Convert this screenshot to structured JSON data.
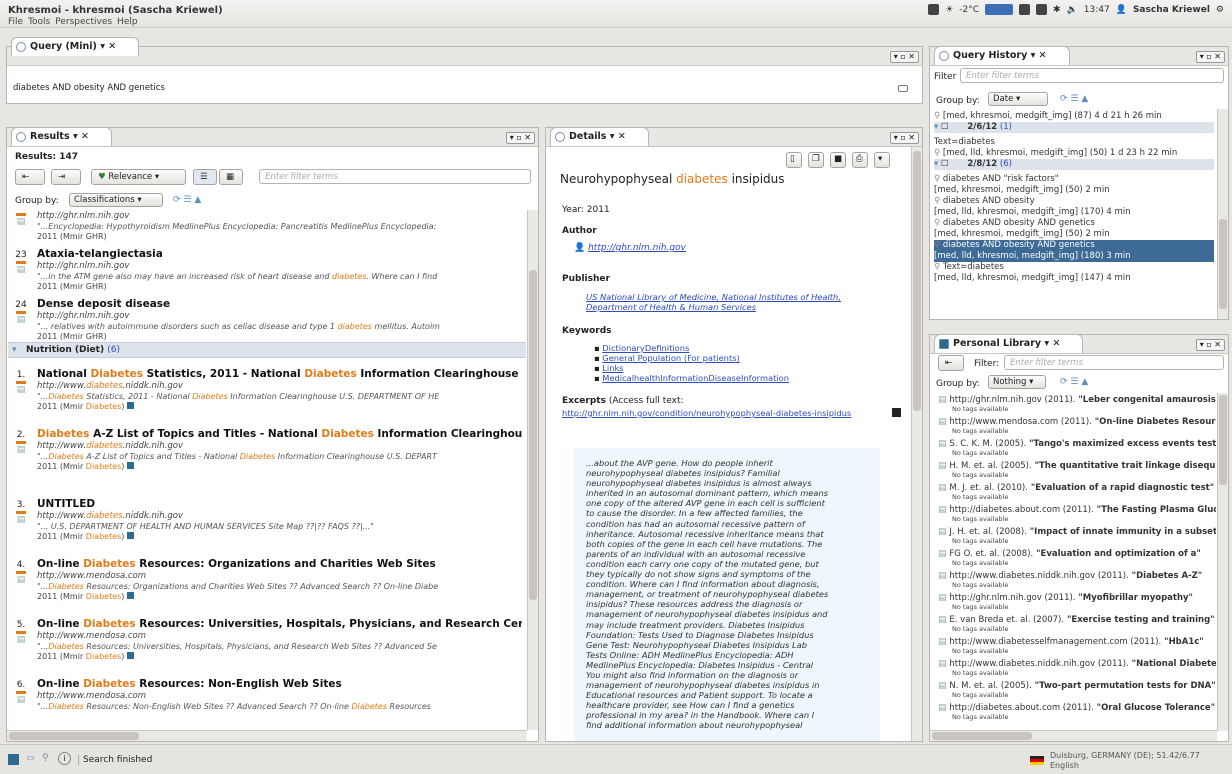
{
  "window": {
    "title": "Khresmoi - khresmoi (Sascha Kriewel)",
    "menu": [
      "File",
      "Tools",
      "Perspectives",
      "Help"
    ]
  },
  "tray": {
    "temp": "-2°C",
    "time": "13:47",
    "user": "Sascha Kriewel"
  },
  "query_pane": {
    "tab": "Query (Mini)",
    "query": "diabetes AND obesity AND genetics"
  },
  "results": {
    "tab": "Results",
    "count": "Results: 147",
    "sort": "Relevance",
    "filter_placeholder": "Enter filter terms",
    "group_label": "Group by:",
    "group_value": "Classifications",
    "group_nutrition": "Nutrition (Diet)",
    "group_nutrition_count": "(6)",
    "items": [
      {
        "rank": "",
        "title": "",
        "url": "http://ghr.nlm.nih.gov",
        "snippet": "\"...Encyclopedia: Hypothyroidism MedlinePlus Encyclopedia: Pancreatitis MedlinePlus Encyclopedia:",
        "date": "2011 (Mmir GHR)"
      },
      {
        "rank": "23",
        "title": "Ataxia-telangiectasia",
        "url": "http://ghr.nlm.nih.gov",
        "snippet": "\"...in the ATM gene also may have an increased risk of heart disease and diabetes. Where can I find",
        "date": "2011 (Mmir GHR)"
      },
      {
        "rank": "24",
        "title": "Dense deposit disease",
        "url": "http://ghr.nlm.nih.gov",
        "snippet": "\"... relatives with autoimmune disorders such as celiac disease and type 1 diabetes mellitus. Autoim",
        "date": "2011 (Mmir GHR)"
      },
      {
        "rank": "1.",
        "title": "National Diabetes Statistics, 2011 - National Diabetes Information Clearinghouse",
        "url": "http://www.diabetes.niddk.nih.gov",
        "snippet": "\"...Diabetes Statistics, 2011 - National Diabetes Information Clearinghouse U.S. DEPARTMENT OF HE",
        "date": "2011 (Mmir Diabetes)"
      },
      {
        "rank": "2.",
        "title": "Diabetes A-Z List of Topics and Titles - National Diabetes Information Clearinghouse",
        "url": "http://www.diabetes.niddk.nih.gov",
        "snippet": "\"...Diabetes A-Z List of Topics and Titles - National Diabetes Information Clearinghouse U.S. DEPART",
        "date": "2011 (Mmir Diabetes)"
      },
      {
        "rank": "3.",
        "title": "UNTITLED",
        "url": "http://www.diabetes.niddk.nih.gov",
        "snippet": "\"... U.S. DEPARTMENT OF HEALTH AND HUMAN SERVICES Site Map ??|?? FAQS ??|...\"",
        "date": "2011 (Mmir Diabetes)"
      },
      {
        "rank": "4.",
        "title": "On-line Diabetes Resources: Organizations and Charities Web Sites",
        "url": "http://www.mendosa.com",
        "snippet": "\"...Diabetes Resources: Organizations and Charities Web Sites ?? Advanced Search ?? On-line Diabe",
        "date": "2011 (Mmir Diabetes)"
      },
      {
        "rank": "5.",
        "title": "On-line Diabetes Resources: Universities, Hospitals, Physicians, and Research Centers",
        "url": "http://www.mendosa.com",
        "snippet": "\"...Diabetes Resources: Universities, Hospitals, Physicians, and Research Web Sites ?? Advanced Se",
        "date": "2011 (Mmir Diabetes)"
      },
      {
        "rank": "6.",
        "title": "On-line Diabetes Resources: Non-English Web Sites",
        "url": "http://www.mendosa.com",
        "snippet": "\"...Diabetes Resources: Non-English Web Sites ?? Advanced Search ?? On-line Diabetes Resources",
        "date": ""
      }
    ]
  },
  "details": {
    "tab": "Details",
    "title_pre": "Neurohypophyseal ",
    "title_hl": "diabetes",
    "title_post": " insipidus",
    "year": "Year: 2011",
    "author_label": "Author",
    "author_link": "http://ghr.nlm.nih.gov",
    "publisher_label": "Publisher",
    "publisher": "US National Library of Medicine, National Institutes of Health, Department of Health & Human Services",
    "keywords_label": "Keywords",
    "keywords": [
      "DictionaryDefinitions",
      "General Population (For patients)",
      "Links",
      "MedicalhealthInformationDiseaseInformation"
    ],
    "excerpt_label": "Excerpts",
    "excerpt_access": "(Access full text:",
    "excerpt_link": "http://ghr.nlm.nih.gov/condition/neurohypophyseal-diabetes-insipidus",
    "excerpt_text": "...about the AVP gene. How do people inherit\nneurohypophyseal diabetes insipidus? Familial\nneurohypophyseal diabetes insipidus is almost always\ninherited in an autosomal dominant pattern, which means\none copy of the altered AVP gene in each cell is sufficient\nto cause the disorder. In a few affected families, the\ncondition has had an autosomal recessive pattern of\ninheritance. Autosomal recessive inheritance means that\nboth copies of the gene in each cell have mutations. The\nparents of an individual with an autosomal recessive\ncondition each carry one copy of the mutated gene, but\nthey typically do not show signs and symptoms of the\ncondition. Where can I find information about diagnosis,\nmanagement, or treatment of neurohypophyseal diabetes\ninsipidus? These resources address the diagnosis or\nmanagement of neurohypophyseal diabetes insipidus and\nmay include treatment providers. Diabetes Insipidus\nFoundation: Tests Used to Diagnose Diabetes Insipidus\nGene Test: Neurohypophyseal Diabetes Insipidus Lab\nTests Online: ADH MedlinePlus Encyclopedia: ADH\nMedlinePlus Encyclopedia: Diabetes Insipidus - Central\nYou might also find information on the diagnosis or\nmanagement of neurohypophyseal diabetes insipidus in\nEducational resources and Patient support. To locate a\nhealthcare provider, see How can I find a genetics\nprofessional in my area? in the Handbook. Where can I\nfind additional information about neurohypophyseal"
  },
  "history": {
    "tab": "Query History",
    "filter_label": "Filter",
    "filter_placeholder": "Enter filter terms",
    "group_label": "Group by:",
    "group_value": "Date",
    "rows": [
      {
        "kind": "q",
        "text": "[med, khresmoi, medgift_img] (87) 4 d 21 h 26 min",
        "sel": false
      },
      {
        "kind": "g",
        "text": "2/6/12",
        "count": "(1)",
        "sel": false
      },
      {
        "kind": "q",
        "text": "Text=diabetes",
        "sel": false
      },
      {
        "kind": "q",
        "text": "[med, lld, khresmoi, medgift_img] (50) 1 d 23 h 22 min",
        "sel": false
      },
      {
        "kind": "g",
        "text": "2/8/12",
        "count": "(6)",
        "sel": false
      },
      {
        "kind": "q",
        "text": "diabetes AND \"risk factors\"",
        "sel": false
      },
      {
        "kind": "q",
        "text": "[med, khresmoi, medgift_img] (50) 2 min",
        "sel": false
      },
      {
        "kind": "q",
        "text": "diabetes AND obesity",
        "sel": false
      },
      {
        "kind": "q",
        "text": "[med, lld, khresmoi, medgift_img] (170) 4 min",
        "sel": false
      },
      {
        "kind": "q",
        "text": "diabetes AND obesity AND genetics",
        "sel": false
      },
      {
        "kind": "q",
        "text": "[med, khresmoi, medgift_img] (50) 2 min",
        "sel": false
      },
      {
        "kind": "q",
        "text": "diabetes AND obesity AND genetics",
        "sel": true
      },
      {
        "kind": "q",
        "text": "[med, lld, khresmoi, medgift_img] (180) 3 min",
        "sel": true
      },
      {
        "kind": "q",
        "text": "Text=diabetes",
        "sel": false
      },
      {
        "kind": "q",
        "text": "[med, lld, khresmoi, medgift_img] (147) 4 min",
        "sel": false
      }
    ]
  },
  "library": {
    "tab": "Personal Library",
    "filter_label": "Filter:",
    "filter_placeholder": "Enter filter terms",
    "group_label": "Group by:",
    "group_value": "Nothing",
    "no_tags": "No tags available",
    "items": [
      {
        "src": "http://ghr.nlm.nih.gov (2011).",
        "title": "\"Leber congenital amaurosis\""
      },
      {
        "src": "http://www.mendosa.com (2011).",
        "title": "\"On-line Diabetes Resources\""
      },
      {
        "src": "S. C. K. M. (2005).",
        "title": "\"Tango's maximized excess events test\""
      },
      {
        "src": "H. M. et. al. (2005).",
        "title": "\"The quantitative trait linkage disequilibrium\""
      },
      {
        "src": "M. J. et. al. (2010).",
        "title": "\"Evaluation of a rapid diagnostic test\""
      },
      {
        "src": "http://diabetes.about.com (2011).",
        "title": "\"The Fasting Plasma Glucose\""
      },
      {
        "src": "J. H. et. al. (2008).",
        "title": "\"Impact of innate immunity in a subset\""
      },
      {
        "src": "FG O. et. al. (2008).",
        "title": "\"Evaluation and optimization of a\""
      },
      {
        "src": "http://www.diabetes.niddk.nih.gov (2011).",
        "title": "\"Diabetes A-Z\""
      },
      {
        "src": "http://ghr.nlm.nih.gov (2011).",
        "title": "\"Myofibrillar myopathy\""
      },
      {
        "src": "E. van Breda et. al. (2007).",
        "title": "\"Exercise testing and training\""
      },
      {
        "src": "http://www.diabetesselfmanagement.com (2011).",
        "title": "\"HbA1c\""
      },
      {
        "src": "http://www.diabetes.niddk.nih.gov (2011).",
        "title": "\"National Diabetes\""
      },
      {
        "src": "N. M. et. al. (2005).",
        "title": "\"Two-part permutation tests for DNA\""
      },
      {
        "src": "http://diabetes.about.com (2011).",
        "title": "\"Oral Glucose Tolerance\""
      }
    ]
  },
  "status": {
    "text": "Search finished",
    "location": "Duisburg, GERMANY (DE); 51.42/6.77",
    "language": "English"
  },
  "colors": {
    "highlight": "#e07b1a",
    "link": "#2c4bbd",
    "selection": "#3e6a96",
    "group": "#dde3ea"
  }
}
